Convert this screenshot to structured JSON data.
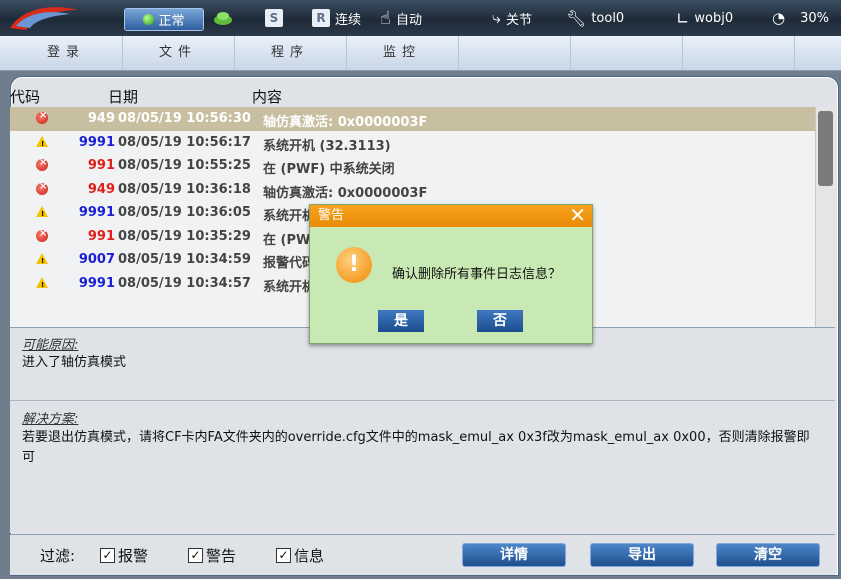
{
  "topbar": {
    "mode_label": "正常",
    "s_label": "S",
    "r_label": "R",
    "run_mode": "连续",
    "auto_label": "自动",
    "joint_label": "关节",
    "tool_label": "tool0",
    "wobj_label": "wobj0",
    "speed": "30%"
  },
  "menu": [
    "登录",
    "文件",
    "程序",
    "监控"
  ],
  "log": {
    "columns": [
      "代码",
      "日期",
      "内容"
    ],
    "rows": [
      {
        "type": "error",
        "code": "949",
        "date": "08/05/19 10:56:30",
        "text": "轴仿真激活: 0x0000003F",
        "selected": true
      },
      {
        "type": "warning",
        "code": "9991",
        "date": "08/05/19 10:56:17",
        "text": "系统开机 (32.3113)"
      },
      {
        "type": "error",
        "code": "991",
        "date": "08/05/19 10:55:25",
        "text": "在 (PWF) 中系统关闭"
      },
      {
        "type": "error",
        "code": "949",
        "date": "08/05/19 10:36:18",
        "text": "轴仿真激活: 0x0000003F"
      },
      {
        "type": "warning",
        "code": "9991",
        "date": "08/05/19 10:36:05",
        "text": "系统开机"
      },
      {
        "type": "error",
        "code": "991",
        "date": "08/05/19 10:35:29",
        "text": "在 (PWF"
      },
      {
        "type": "warning",
        "code": "9007",
        "date": "08/05/19 10:34:59",
        "text": "报警代码"
      },
      {
        "type": "warning",
        "code": "9991",
        "date": "08/05/19 10:34:57",
        "text": "系统开机"
      }
    ]
  },
  "detail": {
    "cause_title": "可能原因:",
    "cause_text": "进入了轴仿真模式",
    "solution_title": "解决方案:",
    "solution_text": "若要退出仿真模式，请将CF卡内FA文件夹内的override.cfg文件中的mask_emul_ax 0x3f改为mask_emul_ax 0x00，否则清除报警即可"
  },
  "footer": {
    "filter_label": "过滤:",
    "checkboxes": [
      "报警",
      "警告",
      "信息"
    ],
    "buttons": [
      "详情",
      "导出",
      "清空"
    ]
  },
  "dialog": {
    "title": "警告",
    "message": "确认删除所有事件日志信息？",
    "yes": "是",
    "no": "否"
  },
  "colors": {
    "error_code": "#e0201a",
    "warning_code": "#1a1fd6",
    "dialog_title": "#f1970f",
    "dialog_bg": "#c8e9b3",
    "button": "#2a5fa6"
  }
}
